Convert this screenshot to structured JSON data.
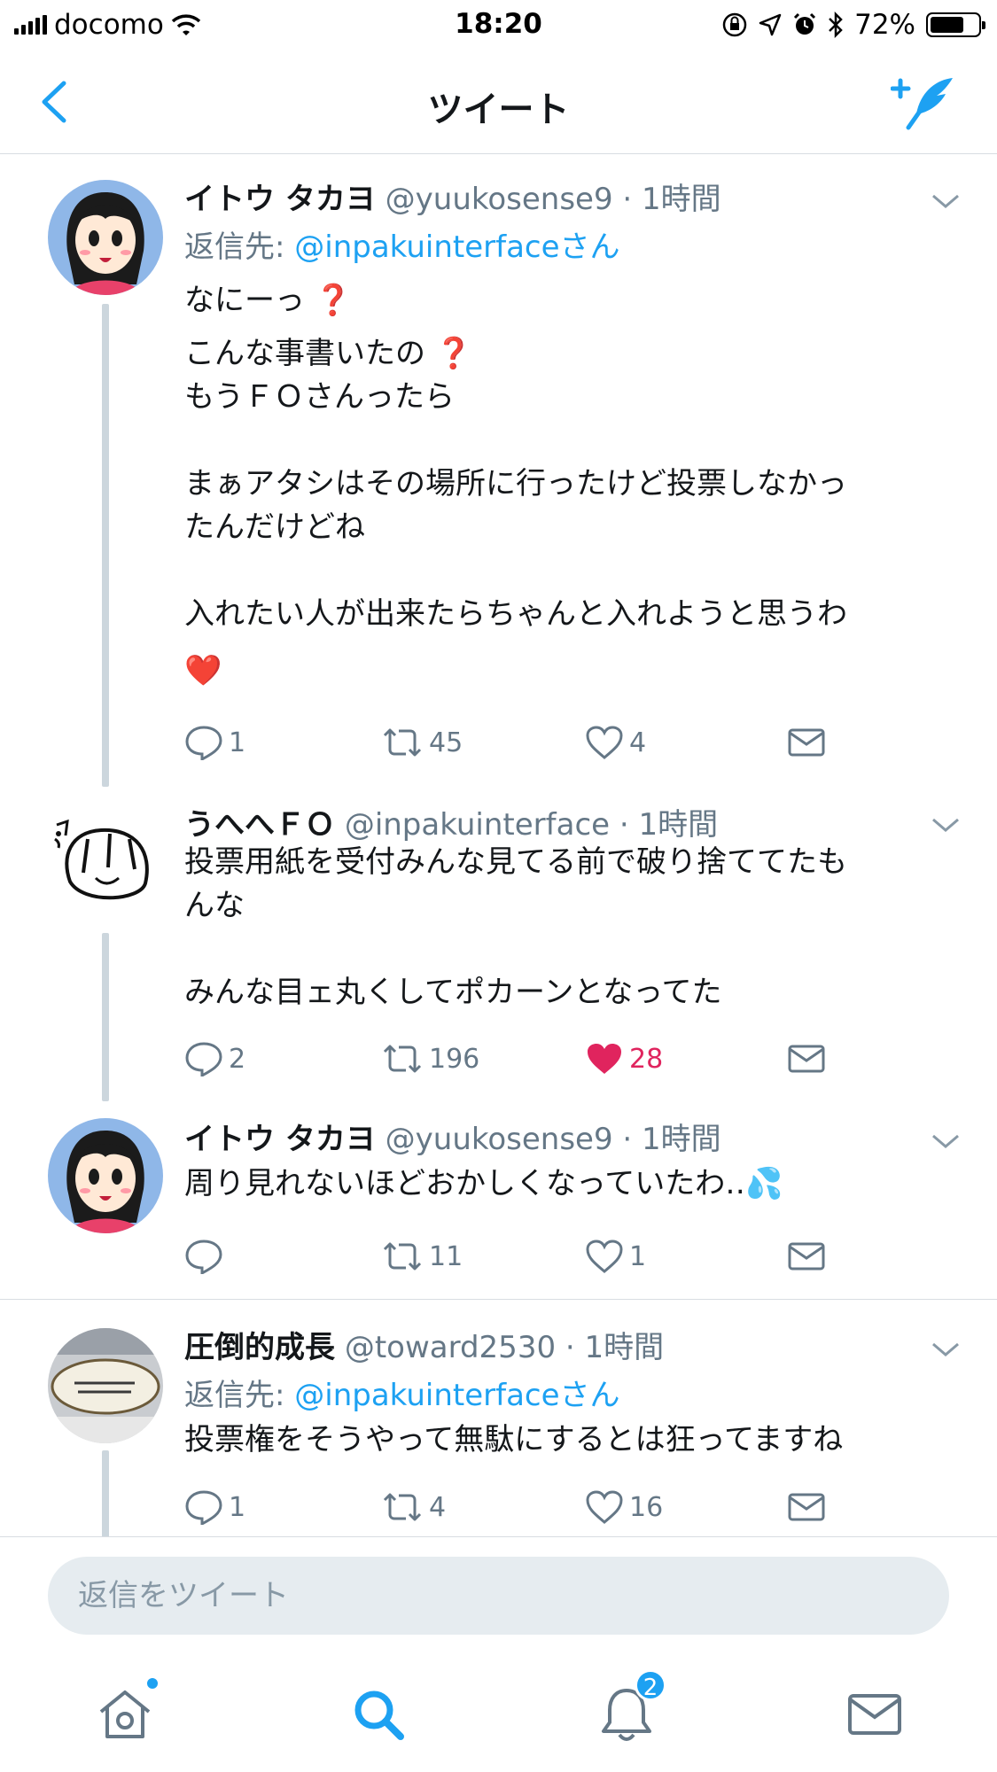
{
  "status_bar": {
    "carrier": "docomo",
    "time": "18:20",
    "battery": "72%",
    "battery_level": 0.72
  },
  "nav": {
    "title": "ツイート"
  },
  "colors": {
    "accent": "#1da1f2",
    "like": "#e0245e",
    "text": "#14171a",
    "meta": "#657786"
  },
  "tweets": [
    {
      "name": "イトウ タカヨ",
      "handle": "@yuukosense9",
      "time": "1時間",
      "reply_label": "返信先: ",
      "reply_to": "@inpakuinterfaceさん",
      "lines": [
        "なにーっ ❓",
        "こんな事書いたの ❓\nもうＦＯさんったら\n\nまぁアタシはその場所に行ったけど投票しなかっ\nたんだけどね\n\n入れたい人が出来たらちゃんと入れようと思うわ",
        "❤️"
      ],
      "replies": "1",
      "retweets": "45",
      "likes": "4"
    },
    {
      "name": "うへへＦＯ",
      "handle": "@inpakuinterface",
      "time": "1時間",
      "lines": [
        "投票用紙を受付みんな見てる前で破り捨ててたも\nんな\n\nみんな目ェ丸くしてポカーンとなってた"
      ],
      "replies": "2",
      "retweets": "196",
      "likes": "28"
    },
    {
      "name": "イトウ タカヨ",
      "handle": "@yuukosense9",
      "time": "1時間",
      "lines": [
        "周り見れないほどおかしくなっていたわ‥💦"
      ],
      "replies": "",
      "retweets": "11",
      "likes": "1"
    },
    {
      "name": "圧倒的成長",
      "handle": "@toward2530",
      "time": "1時間",
      "reply_label": "返信先: ",
      "reply_to": "@inpakuinterfaceさん",
      "lines": [
        "投票権をそうやって無駄にするとは狂ってますね"
      ],
      "replies": "1",
      "retweets": "4",
      "likes": "16"
    }
  ],
  "reply_box": {
    "placeholder": "返信をツイート"
  },
  "tab_bar": {
    "notifications_badge": "2"
  }
}
